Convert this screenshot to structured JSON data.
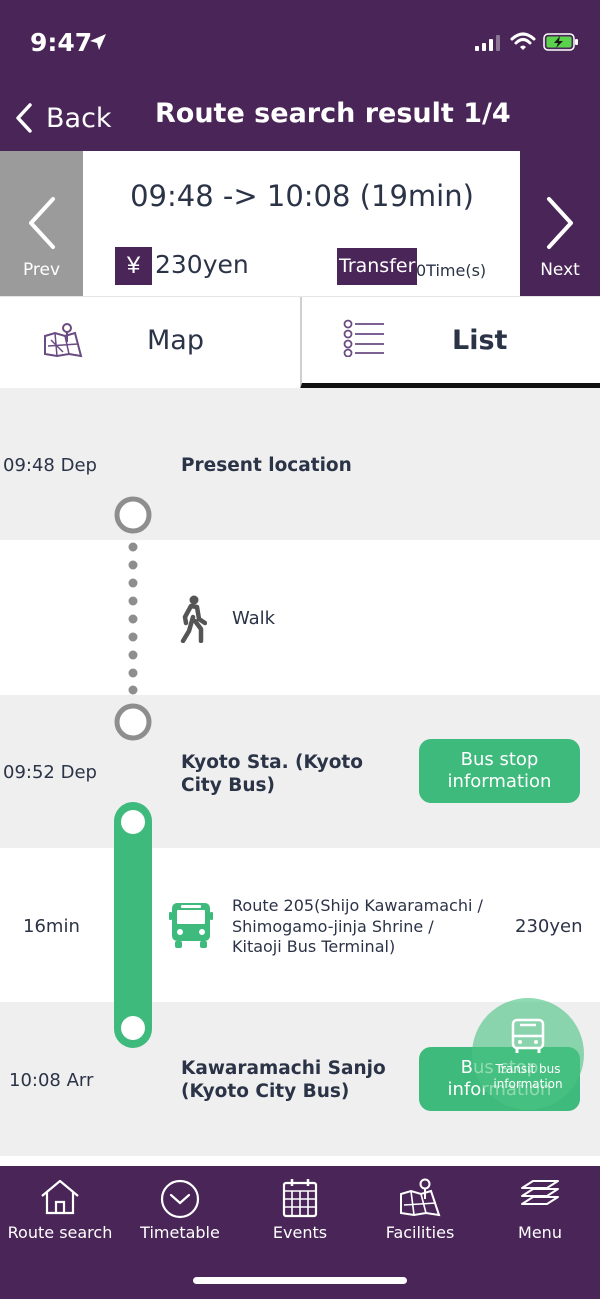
{
  "status_bar": {
    "time": "9:47"
  },
  "nav": {
    "back_label": "Back",
    "title": "Route search result 1/4"
  },
  "summary": {
    "prev_label": "Prev",
    "next_label": "Next",
    "time_range": "09:48 -> 10:08 (19min)",
    "yen_symbol": "¥",
    "fare": "230yen",
    "transfer_label": "Transfer",
    "transfer_count": "0Time(s)"
  },
  "tabs": {
    "map_label": "Map",
    "list_label": "List",
    "active": "List"
  },
  "route": {
    "origin": {
      "time": "09:48 Dep",
      "name": "Present location"
    },
    "walk": {
      "label": "Walk"
    },
    "boarding": {
      "time": "09:52 Dep",
      "name_line1": "Kyoto Sta. (Kyoto",
      "name_line2": "City Bus)",
      "button_line1": "Bus stop",
      "button_line2": "information"
    },
    "bus_leg": {
      "duration": "16min",
      "route_line1": "Route 205(Shijo Kawaramachi /",
      "route_line2": "Shimogamo-jinja Shrine /",
      "route_line3": "Kitaoji Bus Terminal)",
      "fare": "230yen"
    },
    "alighting": {
      "time": "10:08 Arr",
      "name_line1": "Kawaramachi Sanjo",
      "name_line2": "(Kyoto City Bus)",
      "button_line1": "Bus stop",
      "button_line2": "information"
    }
  },
  "fab": {
    "label_line1": "Transit bus",
    "label_line2": "information",
    "icon": "bus-icon"
  },
  "tabbar": {
    "items": [
      {
        "label": "Route search",
        "icon": "home-icon"
      },
      {
        "label": "Timetable",
        "icon": "clock-icon"
      },
      {
        "label": "Events",
        "icon": "calendar-icon"
      },
      {
        "label": "Facilities",
        "icon": "map-icon"
      },
      {
        "label": "Menu",
        "icon": "layers-icon"
      }
    ]
  },
  "colors": {
    "brand": "#4a2558",
    "accent_green": "#3dba7c",
    "prev_gray": "#9b9b9b",
    "row_gray": "#efefef"
  }
}
